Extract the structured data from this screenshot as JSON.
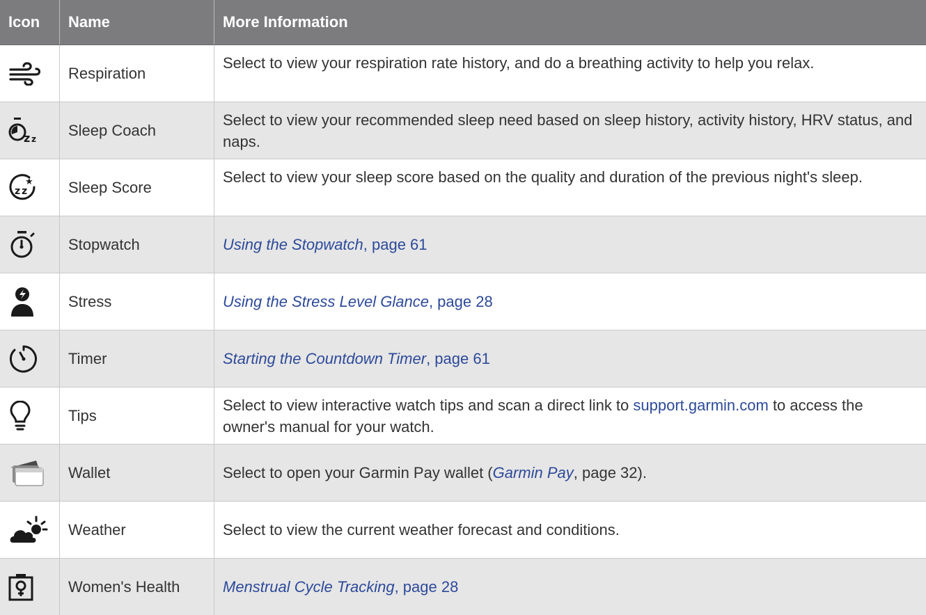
{
  "header": {
    "col_icon": "Icon",
    "col_name": "Name",
    "col_info": "More Information"
  },
  "rows": [
    {
      "icon": "respiration-wind-icon",
      "name": "Respiration",
      "info": "Select to view your respiration rate history, and do a breathing activity to help you relax."
    },
    {
      "icon": "sleep-coach-icon",
      "name": "Sleep Coach",
      "info": "Select to view your recommended sleep need based on sleep history, activity history, HRV status, and naps."
    },
    {
      "icon": "sleep-score-icon",
      "name": "Sleep Score",
      "info": "Select to view your sleep score based on the quality and duration of the previous night's sleep."
    },
    {
      "icon": "stopwatch-icon",
      "name": "Stopwatch",
      "link_text": "Using the Stopwatch",
      "after_text": ", page 61"
    },
    {
      "icon": "stress-icon",
      "name": "Stress",
      "link_text": "Using the Stress Level Glance",
      "after_text": ", page 28"
    },
    {
      "icon": "timer-icon",
      "name": "Timer",
      "link_text": "Starting the Countdown Timer",
      "after_text": ", page 61"
    },
    {
      "icon": "lightbulb-icon",
      "name": "Tips",
      "info_before": "Select to view interactive watch tips and scan a direct link to ",
      "info_link": "support.garmin.com",
      "info_after": " to access the owner's manual for your watch."
    },
    {
      "icon": "wallet-cards-icon",
      "name": "Wallet",
      "info_before": "Select to open your Garmin Pay wallet (",
      "info_link": "Garmin Pay",
      "info_after": ", page 32)."
    },
    {
      "icon": "weather-cloud-sun-icon",
      "name": "Weather",
      "info": "Select to view the current weather forecast and conditions."
    },
    {
      "icon": "womens-health-icon",
      "name": "Women's Health",
      "link_text": "Menstrual Cycle Tracking",
      "after_text": ", page 28"
    }
  ],
  "colors": {
    "header_bg": "#7c7c7e",
    "alt_row_bg": "#e6e6e6",
    "link": "#2d4a9a"
  }
}
